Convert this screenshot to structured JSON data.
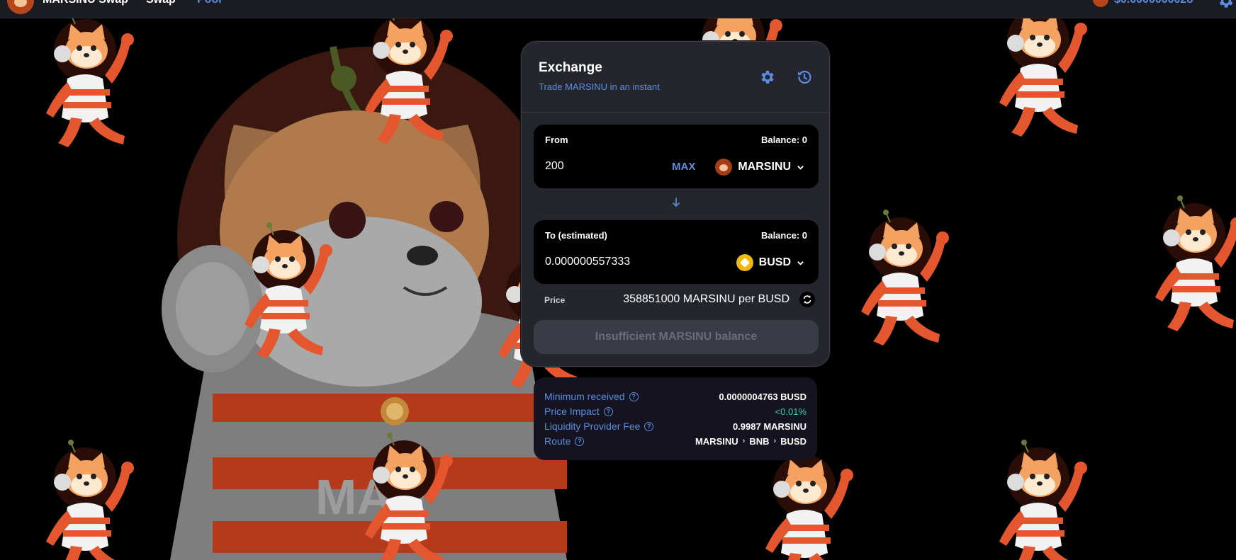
{
  "nav": {
    "brand_name": "MARSINU Swap",
    "swap_label": "Swap",
    "pool_label": "Pool",
    "token_price": "$0.0000000028",
    "brand_icon": "marsinu-logo-icon",
    "settings_icon": "gear-icon"
  },
  "exchange": {
    "title": "Exchange",
    "subtitle": "Trade MARSINU in an instant",
    "settings_icon": "gear-icon",
    "history_icon": "history-icon",
    "from": {
      "label": "From",
      "balance": "Balance: 0",
      "amount": "200",
      "max_label": "MAX",
      "token": "MARSINU"
    },
    "swap_direction_icon": "arrow-down-icon",
    "to": {
      "label": "To (estimated)",
      "balance": "Balance: 0",
      "amount": "0.000000557333",
      "token": "BUSD"
    },
    "price_label": "Price",
    "price_value": "358851000 MARSINU per BUSD",
    "action_button": "Insufficient MARSINU balance"
  },
  "details": {
    "rows": [
      {
        "label": "Minimum received",
        "value": "0.0000004763 BUSD"
      },
      {
        "label": "Price Impact",
        "value": "<0.01%"
      },
      {
        "label": "Liquidity Provider Fee",
        "value": "0.9987 MARSINU"
      },
      {
        "label": "Route"
      }
    ],
    "route": [
      "MARSINU",
      "BNB",
      "BUSD"
    ],
    "help_icon": "question-circle-icon"
  },
  "colors": {
    "accent": "#5a8de3",
    "background": "#000000",
    "card": "#25262d",
    "positive": "#31d0aa",
    "mascot_orange": "#e4572e"
  }
}
